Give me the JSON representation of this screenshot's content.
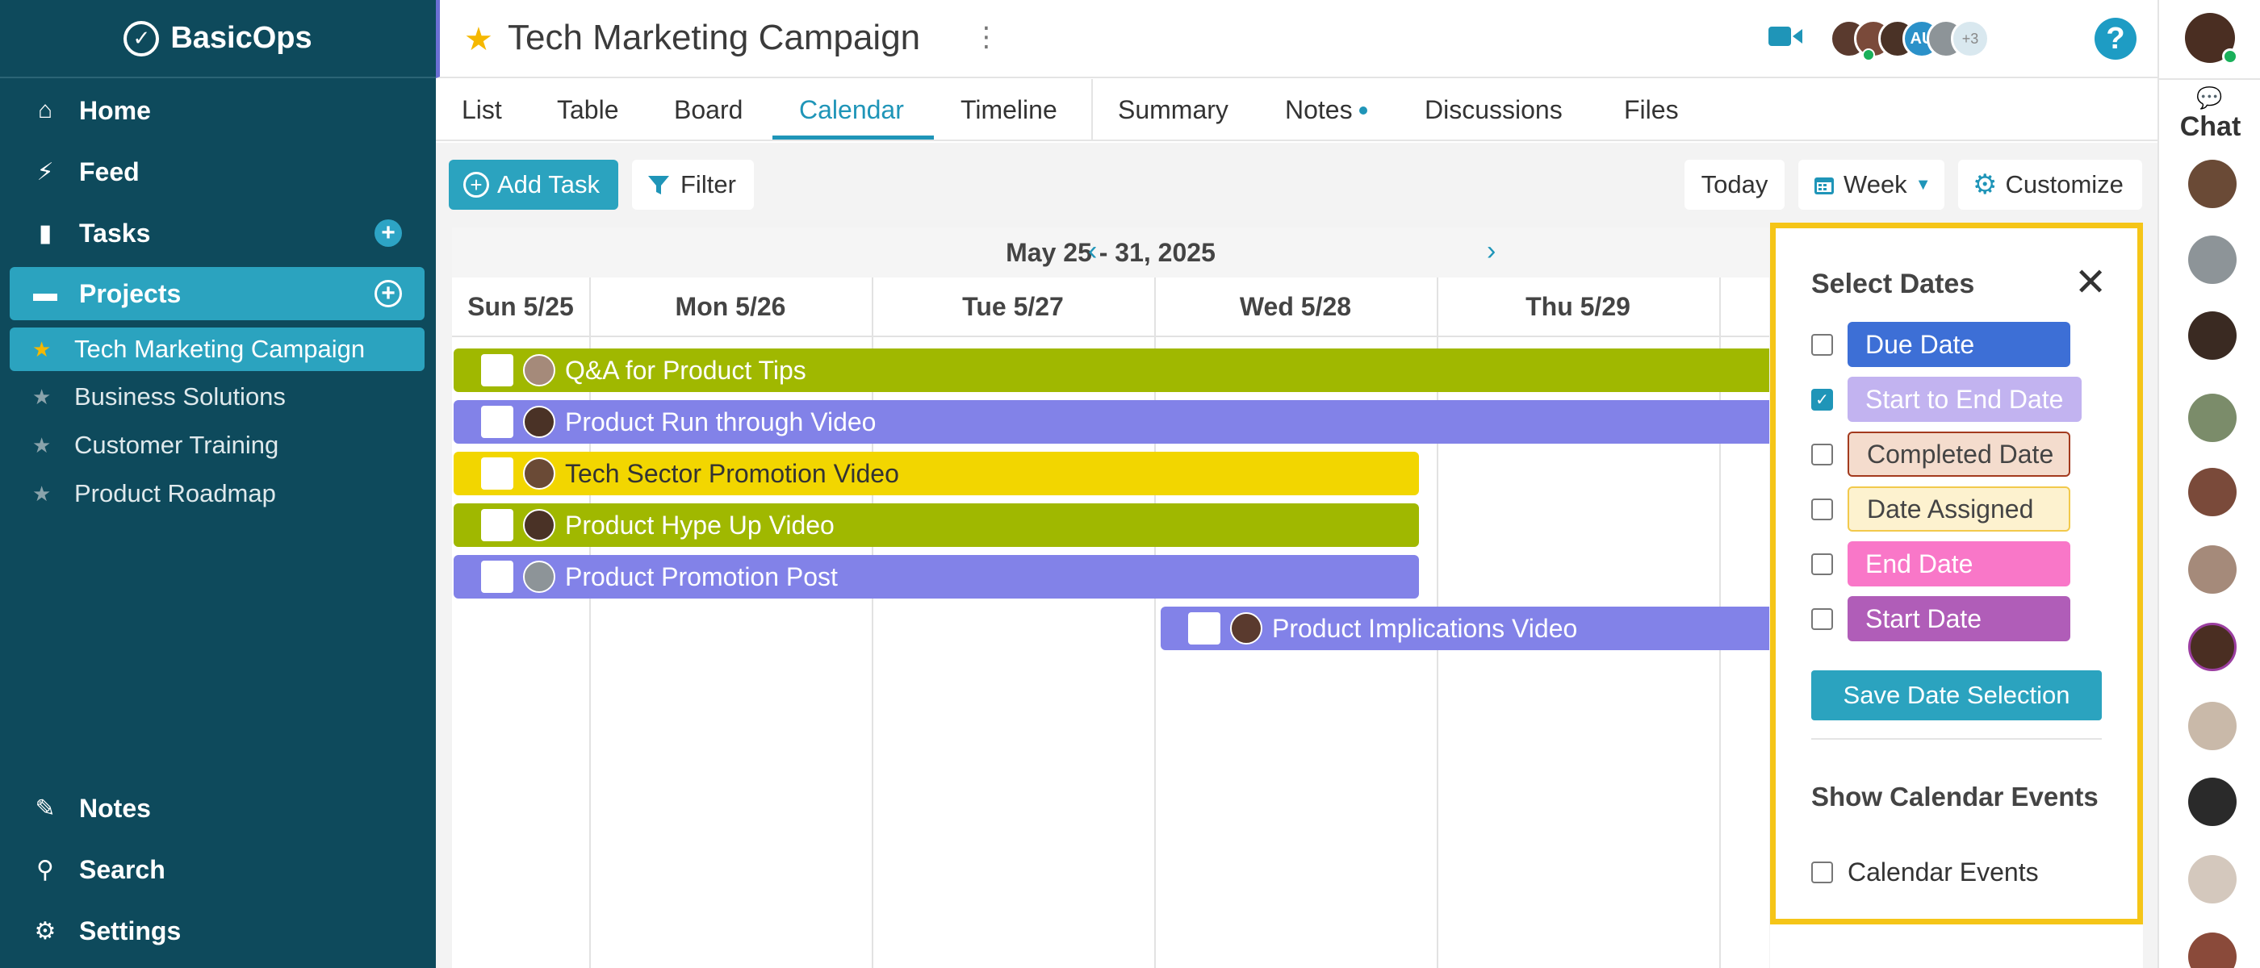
{
  "app": {
    "logo_text": "BasicOps"
  },
  "sidebar": {
    "nav_top": [
      {
        "label": "Home",
        "icon": "home-icon"
      },
      {
        "label": "Feed",
        "icon": "activity-icon"
      },
      {
        "label": "Tasks",
        "icon": "clipboard-icon"
      },
      {
        "label": "Projects",
        "icon": "folder-icon"
      }
    ],
    "projects": [
      {
        "label": "Tech Marketing Campaign",
        "active": true
      },
      {
        "label": "Business Solutions"
      },
      {
        "label": "Customer Training"
      },
      {
        "label": "Product Roadmap"
      }
    ],
    "nav_bottom": [
      {
        "label": "Notes",
        "icon": "pencil-icon"
      },
      {
        "label": "Search",
        "icon": "search-icon"
      },
      {
        "label": "Settings",
        "icon": "gear-icon"
      }
    ]
  },
  "header": {
    "title": "Tech Marketing Campaign",
    "members_more": "+3",
    "member_initials": "AU",
    "help": "?"
  },
  "tabs": [
    "List",
    "Table",
    "Board",
    "Calendar",
    "Timeline",
    "Summary",
    "Notes",
    "Discussions",
    "Files"
  ],
  "active_tab": "Calendar",
  "toolbar": {
    "add_task": "Add Task",
    "filter": "Filter",
    "today": "Today",
    "week": "Week",
    "customize": "Customize"
  },
  "calendar": {
    "range": "May 25 - 31, 2025",
    "days": [
      "Sun 5/25",
      "Mon 5/26",
      "Tue 5/27",
      "Wed 5/28",
      "Thu 5/29"
    ],
    "tasks": [
      {
        "label": "Q&A for Product Tips",
        "color": "#a0b800"
      },
      {
        "label": "Product Run through Video",
        "color": "#8282e8"
      },
      {
        "label": "Tech Sector Promotion Video",
        "color": "#f2d600"
      },
      {
        "label": "Product Hype Up Video",
        "color": "#a0b800"
      },
      {
        "label": "Product Promotion Post",
        "color": "#8282e8"
      },
      {
        "label": "Product Implications Video",
        "color": "#8282e8"
      }
    ]
  },
  "date_popover": {
    "title": "Select Dates",
    "options": [
      {
        "label": "Due Date",
        "checked": false,
        "bg": "#3d6fd6",
        "fg": "#ffffff",
        "border": "#3d6fd6"
      },
      {
        "label": "Start to End Date",
        "checked": true,
        "bg": "#c2b3f0",
        "fg": "#ffffff",
        "border": "#c2b3f0"
      },
      {
        "label": "Completed Date",
        "checked": false,
        "bg": "#f4dccd",
        "fg": "#444444",
        "border": "#a33a1e"
      },
      {
        "label": "Date Assigned",
        "checked": false,
        "bg": "#fdf2cf",
        "fg": "#444444",
        "border": "#f2c94c"
      },
      {
        "label": "End Date",
        "checked": false,
        "bg": "#f977c8",
        "fg": "#ffffff",
        "border": "#f977c8"
      },
      {
        "label": "Start Date",
        "checked": false,
        "bg": "#b05db8",
        "fg": "#ffffff",
        "border": "#b05db8"
      }
    ],
    "save_label": "Save Date Selection",
    "events_title": "Show Calendar Events",
    "events_label": "Calendar Events"
  },
  "chat": {
    "label": "Chat"
  },
  "colors": {
    "sidebar_bg": "#0e4a5c",
    "accent": "#2ba3bf",
    "highlight": "#f5c518"
  }
}
